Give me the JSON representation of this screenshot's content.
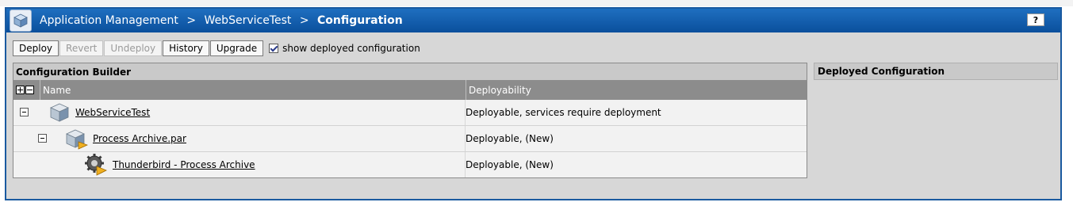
{
  "header": {
    "crumb_app_management": "Application Management",
    "separator": ">",
    "crumb_service": "WebServiceTest",
    "crumb_current": "Configuration",
    "help_label": "?"
  },
  "toolbar": {
    "deploy": "Deploy",
    "revert": "Revert",
    "undeploy": "Undeploy",
    "history": "History",
    "upgrade": "Upgrade",
    "show_deployed_label": "show deployed configuration",
    "show_deployed_checked": true
  },
  "builder": {
    "title": "Configuration Builder",
    "columns": {
      "name": "Name",
      "deployability": "Deployability"
    },
    "rows": [
      {
        "name": "WebServiceTest",
        "deployability": "Deployable, services require deployment",
        "icon": "application-cube-icon"
      },
      {
        "name": "Process Archive.par",
        "deployability": "Deployable, (New)",
        "icon": "archive-cube-icon"
      },
      {
        "name": "Thunderbird - Process Archive",
        "deployability": "Deployable, (New)",
        "icon": "process-gear-icon"
      }
    ]
  },
  "deployed": {
    "title": "Deployed Configuration"
  },
  "colors": {
    "title_bar": "#0a4f9c",
    "panel_bg": "#d7d7d7",
    "grid_header": "#8c8c8c"
  }
}
